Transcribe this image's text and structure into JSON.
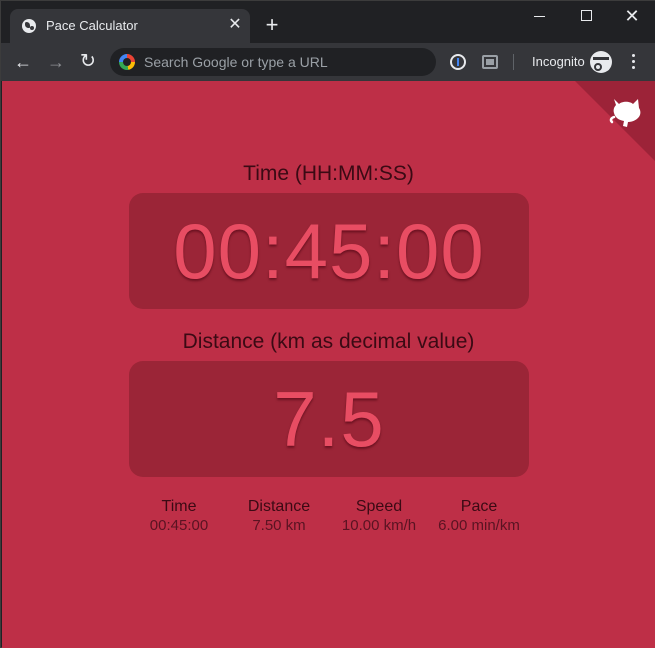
{
  "browser": {
    "tab_title": "Pace Calculator",
    "tab_close": "✕",
    "new_tab": "+",
    "close_window": "✕",
    "omnibox_placeholder": "Search Google or type a URL",
    "incognito_label": "Incognito",
    "back": "←",
    "forward": "→",
    "reload": "↻"
  },
  "page": {
    "background": "#be2f47",
    "time_label": "Time (HH:MM:SS)",
    "time_value": "00:45:00",
    "distance_label": "Distance (km as decimal value)",
    "distance_value": "7.5",
    "summary": [
      {
        "heading": "Time",
        "value": "00:45:00"
      },
      {
        "heading": "Distance",
        "value": "7.50 km"
      },
      {
        "heading": "Speed",
        "value": "10.00 km/h"
      },
      {
        "heading": "Pace",
        "value": "6.00 min/km"
      }
    ]
  },
  "icons": {
    "tab_favicon": "globe-icon",
    "corner": "github-octocat-icon"
  }
}
